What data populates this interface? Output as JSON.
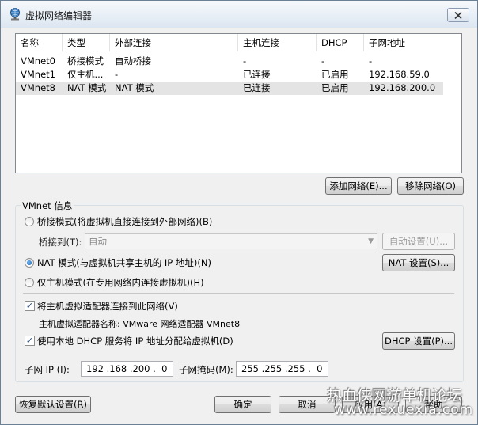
{
  "window": {
    "title": "虚拟网络编辑器"
  },
  "table": {
    "columns": [
      "名称",
      "类型",
      "外部连接",
      "主机连接",
      "DHCP",
      "子网地址"
    ],
    "rows": [
      [
        "VMnet0",
        "桥接模式",
        "自动桥接",
        "-",
        "-",
        "-"
      ],
      [
        "VMnet1",
        "仅主机...",
        "-",
        "已连接",
        "已启用",
        "192.168.59.0"
      ],
      [
        "VMnet8",
        "NAT 模式",
        "NAT 模式",
        "已连接",
        "已启用",
        "192.168.200.0"
      ]
    ]
  },
  "buttons": {
    "add_network": "添加网络(E)...",
    "remove_network": "移除网络(O)",
    "auto_settings": "自动设置(U)...",
    "nat_settings": "NAT 设置(S)...",
    "dhcp_settings": "DHCP 设置(P)...",
    "restore_defaults": "恢复默认设置(R)",
    "ok": "确定",
    "cancel": "取消",
    "apply": "应用(A)",
    "help": "帮助"
  },
  "vmnet_info": {
    "group_label": "VMnet 信息",
    "bridged_label": "桥接模式(将虚拟机直接连接到外部网络)(B)",
    "bridged_to_label": "桥接到(T):",
    "bridged_to_value": "自动",
    "nat_label": "NAT 模式(与虚拟机共享主机的 IP 地址)(N)",
    "host_only_label": "仅主机模式(在专用网络内连接虚拟机)(H)",
    "selected_mode": "nat",
    "connect_adapter_label": "将主机虚拟适配器连接到此网络(V)",
    "connect_adapter_checked": true,
    "adapter_name_label": "主机虚拟适配器名称: VMware 网络适配器 VMnet8",
    "dhcp_label": "使用本地 DHCP 服务将 IP 地址分配给虚拟机(D)",
    "dhcp_checked": true,
    "subnet_ip_label": "子网 IP (I):",
    "subnet_ip": "192 .168 .200 .  0",
    "subnet_mask_label": "子网掩码(M):",
    "subnet_mask": "255 .255 .255 .  0"
  },
  "watermark": {
    "line1": "热血侠网游单机论坛",
    "line2": "www.rexuexia.com"
  },
  "colors": {
    "selected_row": "#e4e4e4",
    "radio_dot": "#1a5fb4"
  }
}
